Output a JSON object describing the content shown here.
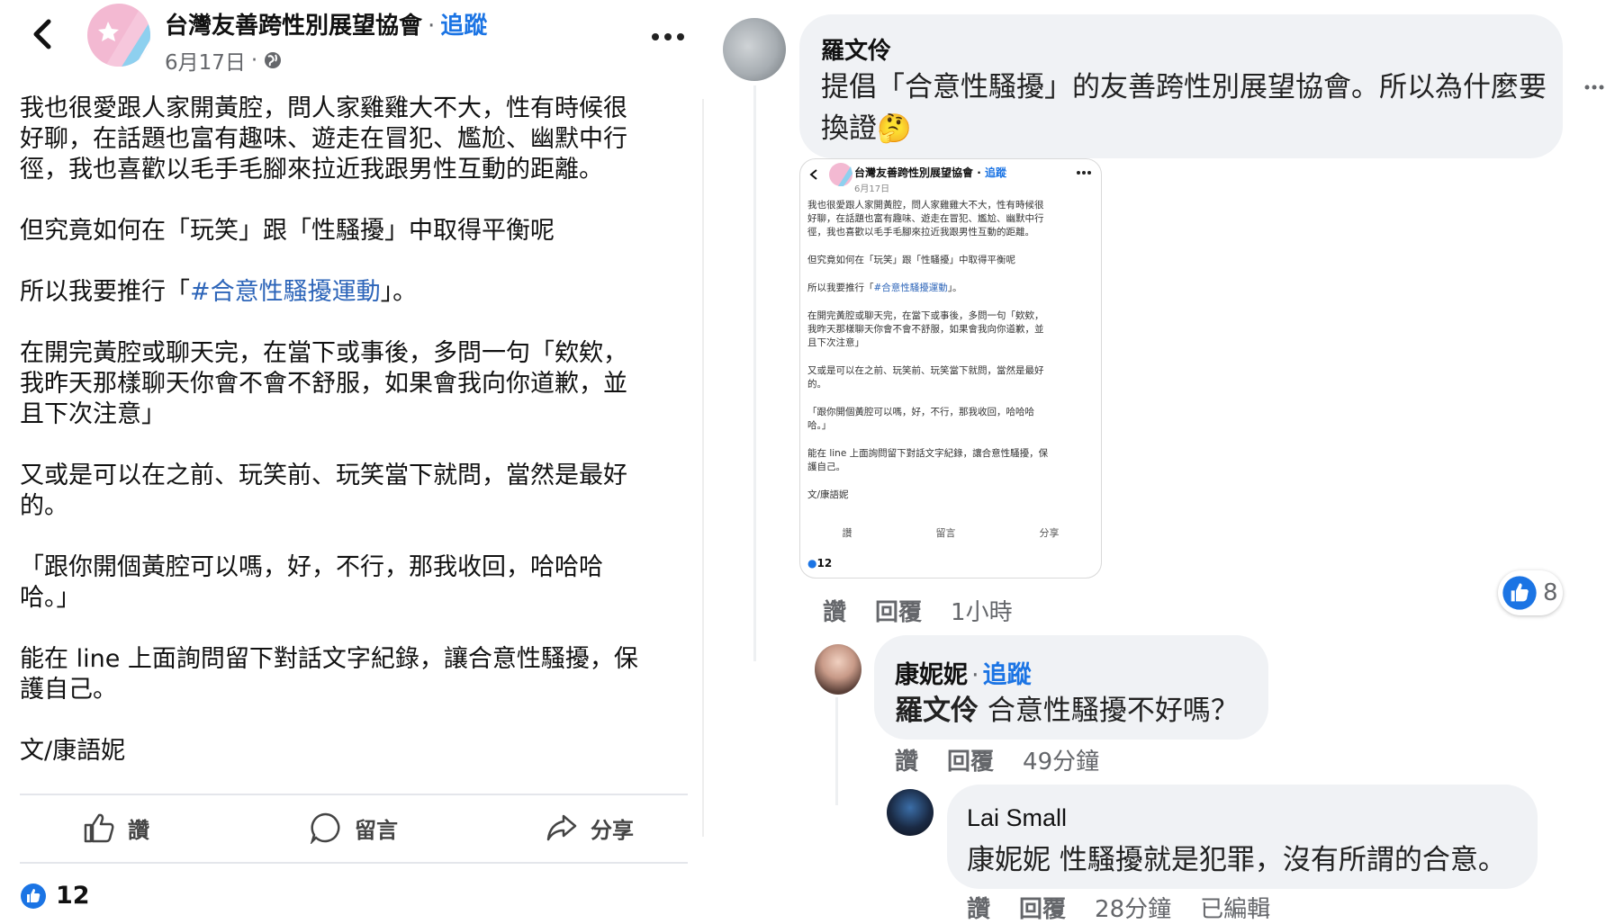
{
  "post": {
    "page_name": "台灣友善跨性別展望協會",
    "follow_label": "追蹤",
    "date": "6月17日",
    "paragraphs": [
      "我也很愛跟人家開黃腔，問人家雞雞大不大，性有時候很\n好聊，在話題也富有趣味、遊走在冒犯、尷尬、幽默中行\n徑，我也喜歡以毛手毛腳來拉近我跟男性互動的距離。",
      "但究竟如何在「玩笑」跟「性騷擾」中取得平衡呢",
      "在開完黃腔或聊天完，在當下或事後，多問一句「欸欸，\n我昨天那樣聊天你會不會不舒服，如果會我向你道歉，並\n且下次注意」",
      "又或是可以在之前、玩笑前、玩笑當下就問，當然是最好\n的。",
      "「跟你開個黃腔可以嗎，好，不行，那我收回，哈哈哈\n哈。」",
      "能在 line 上面詢問留下對話文字紀錄，讓合意性騷擾，保\n護自己。",
      "文/康語妮"
    ],
    "campaign_prefix": "所以我要推行「",
    "campaign_hashtag": "#合意性騷擾運動",
    "campaign_suffix": "」。",
    "actions": {
      "like": "讚",
      "comment": "留言",
      "share": "分享"
    },
    "like_count": "12"
  },
  "comments": {
    "luo": {
      "name": "羅文伶",
      "text": "提倡「合意性騷擾」的友善跨性別展望協會。所以為什麼要換證🤔",
      "actions": {
        "like": "讚",
        "reply": "回覆",
        "time": "1小時"
      },
      "reaction_count": "8"
    },
    "kang": {
      "name": "康妮妮",
      "follow_label": "追蹤",
      "mention": "羅文伶",
      "text": "合意性騷擾不好嗎？",
      "actions": {
        "like": "讚",
        "reply": "回覆",
        "time": "49分鐘"
      }
    },
    "lai": {
      "name": "Lai Small",
      "mention": "康妮妮",
      "text": "性騷擾就是犯罪，沒有所謂的合意。",
      "actions": {
        "like": "讚",
        "reply": "回覆",
        "time": "28分鐘",
        "edited": "已編輯"
      }
    }
  },
  "colors": {
    "link_blue": "#1b74e4",
    "hashtag_blue": "#2d65b9",
    "bubble_gray": "#f0f2f5",
    "meta_gray": "#65676b"
  },
  "icons": [
    "back-arrow-icon",
    "globe-icon",
    "more-icon",
    "like-icon",
    "comment-icon",
    "share-icon",
    "thumbs-up-reaction-icon"
  ]
}
